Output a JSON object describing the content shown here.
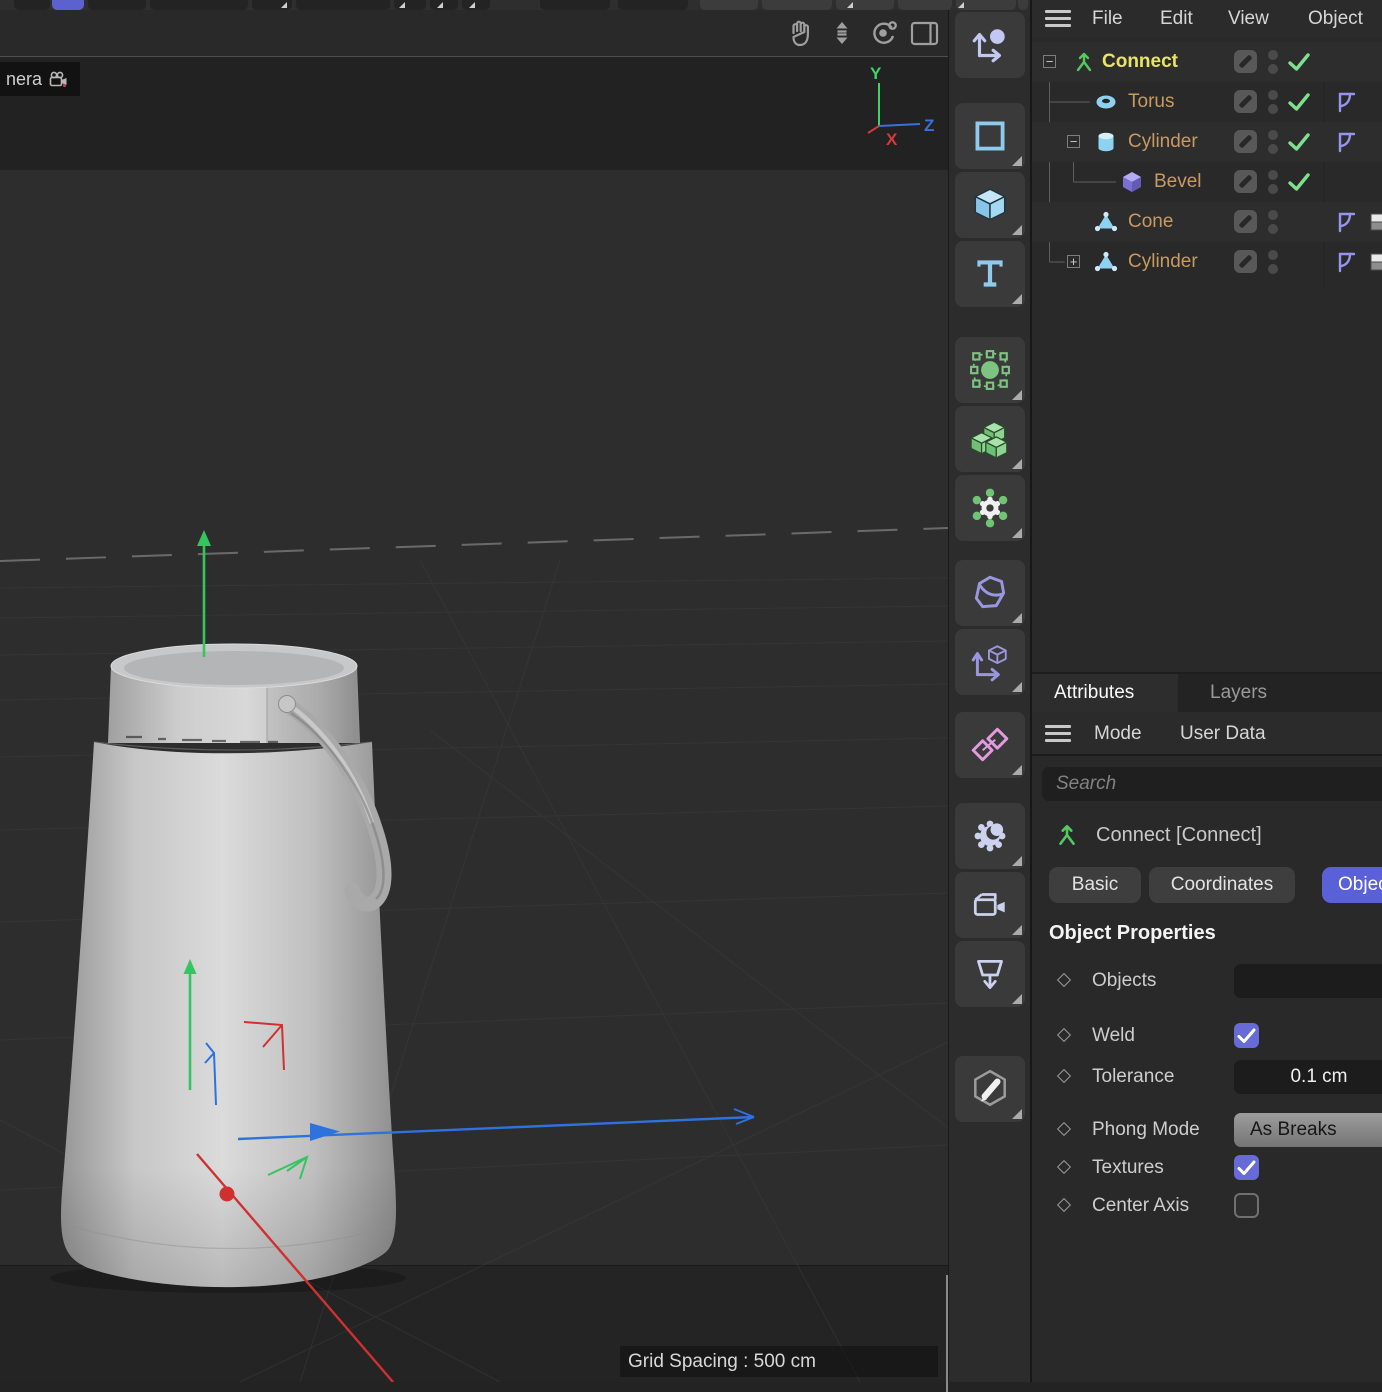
{
  "viewport": {
    "camera_label": "nera",
    "axis_labels": {
      "y": "Y",
      "z": "Z",
      "x": "X"
    },
    "grid_spacing": "Grid Spacing : 500 cm",
    "view_controls": [
      "pan",
      "dolly",
      "rotate",
      "layout-toggle"
    ]
  },
  "menu_bar": {
    "items": [
      "File",
      "Edit",
      "View",
      "Object"
    ]
  },
  "object_tree": {
    "items": [
      {
        "label": "Connect",
        "icon": "connect",
        "color": "#e9e464",
        "bold": true,
        "depth": 0,
        "expand": "minus",
        "check": true,
        "tags": []
      },
      {
        "label": "Torus",
        "icon": "torus",
        "color": "#c79a62",
        "bold": false,
        "depth": 1,
        "expand": "",
        "check": true,
        "tags": [
          "phong"
        ]
      },
      {
        "label": "Cylinder",
        "icon": "cylinder",
        "color": "#c79a62",
        "bold": false,
        "depth": 1,
        "expand": "minus",
        "check": true,
        "tags": [
          "phong"
        ]
      },
      {
        "label": "Bevel",
        "icon": "bevel",
        "color": "#c79a62",
        "bold": false,
        "depth": 2,
        "expand": "",
        "check": true,
        "tags": []
      },
      {
        "label": "Cone",
        "icon": "cone",
        "color": "#c79a62",
        "bold": false,
        "depth": 1,
        "expand": "",
        "check": false,
        "tags": [
          "phong",
          "texture"
        ]
      },
      {
        "label": "Cylinder",
        "icon": "cone",
        "color": "#c79a62",
        "bold": false,
        "depth": 1,
        "expand": "plus",
        "check": false,
        "tags": [
          "phong",
          "texture"
        ]
      }
    ]
  },
  "tool_column": {
    "tools": [
      {
        "name": "move-axis-tool",
        "icon": "moveAxis",
        "flyout": false
      },
      {
        "name": "rectangle-spline-tool",
        "icon": "rectSpline",
        "flyout": true
      },
      {
        "name": "cube-primitive-tool",
        "icon": "cube",
        "flyout": true
      },
      {
        "name": "text-primitive-tool",
        "icon": "text",
        "flyout": true
      },
      {
        "name": "subdivision-surface-tool",
        "icon": "sds",
        "flyout": true
      },
      {
        "name": "volume-generator-tool",
        "icon": "cubes",
        "flyout": true
      },
      {
        "name": "simulation-generator-tool",
        "icon": "gear",
        "flyout": true
      },
      {
        "name": "bend-deformer-tool",
        "icon": "bend",
        "flyout": true
      },
      {
        "name": "axis-modify-tool",
        "icon": "axisCube",
        "flyout": true
      },
      {
        "name": "fields-tool",
        "icon": "fields",
        "flyout": true
      },
      {
        "name": "light-tool",
        "icon": "light",
        "flyout": true
      },
      {
        "name": "camera-tool",
        "icon": "camera",
        "flyout": true
      },
      {
        "name": "floor-tool",
        "icon": "floor",
        "flyout": true
      },
      {
        "name": "annotation-tool",
        "icon": "pencil",
        "flyout": true
      }
    ]
  },
  "attributes_panel": {
    "tabs": [
      {
        "label": "Attributes",
        "active": true
      },
      {
        "label": "Layers",
        "active": false
      }
    ],
    "mode_bar": {
      "items": [
        "Mode",
        "User Data"
      ]
    },
    "search_placeholder": "Search",
    "object_title": "Connect [Connect]",
    "section_tabs": [
      {
        "label": "Basic",
        "active": false
      },
      {
        "label": "Coordinates",
        "active": false
      },
      {
        "label": "Object",
        "active": true
      }
    ],
    "section_heading": "Object Properties",
    "rows": [
      {
        "label": "Objects",
        "control": "input",
        "value": ""
      },
      {
        "label": "Weld",
        "control": "checkbox",
        "checked": true
      },
      {
        "label": "Tolerance",
        "control": "input",
        "value": "0.1 cm"
      },
      {
        "label": "Phong Mode",
        "control": "dropdown",
        "value": "As Breaks"
      },
      {
        "label": "Textures",
        "control": "checkbox",
        "checked": true
      },
      {
        "label": "Center Axis",
        "control": "checkbox",
        "checked": false
      }
    ]
  },
  "colors": {
    "accent_blue": "#5b62cf",
    "selection_blue": "#5a60d8",
    "check_green": "#7fe08d",
    "connect_yellow": "#e9e464",
    "item_orange": "#c79a62",
    "icon_blue": "#8ed2f2",
    "icon_green": "#7cc47f",
    "icon_purple": "#9a97e0",
    "icon_pink": "#e39ae0"
  }
}
